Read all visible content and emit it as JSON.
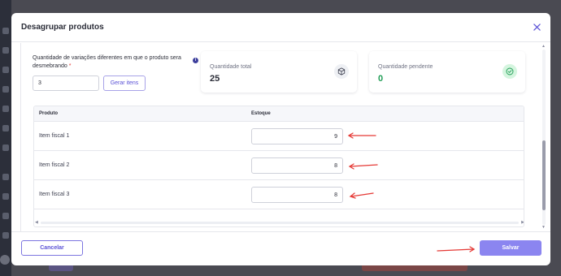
{
  "modal": {
    "title": "Desagrupar produtos"
  },
  "form": {
    "variations_label": "Quantidade de variações diferentes em que o produto sera desmebrando",
    "required_mark": "*",
    "variations_value": "3",
    "generate_button": "Gerar itens"
  },
  "summary": {
    "total_label": "Quantidade total",
    "total_value": "25",
    "pending_label": "Quantidade pendente",
    "pending_value": "0"
  },
  "table": {
    "columns": [
      "Produto",
      "Estoque"
    ],
    "rows": [
      {
        "product": "Item fiscal 1",
        "stock": "9"
      },
      {
        "product": "Item fiscal 2",
        "stock": "8"
      },
      {
        "product": "Item fiscal 3",
        "stock": "8"
      }
    ]
  },
  "footer": {
    "cancel_label": "Cancelar",
    "save_label": "Salvar"
  },
  "colors": {
    "accent": "#5b52d6",
    "save_button": "#8b85f0",
    "success": "#1f9d55",
    "annotation_arrow": "#e53935"
  },
  "icons": {
    "close": "close-icon",
    "info": "info-icon",
    "total": "box-icon",
    "pending": "check-circle-icon"
  }
}
